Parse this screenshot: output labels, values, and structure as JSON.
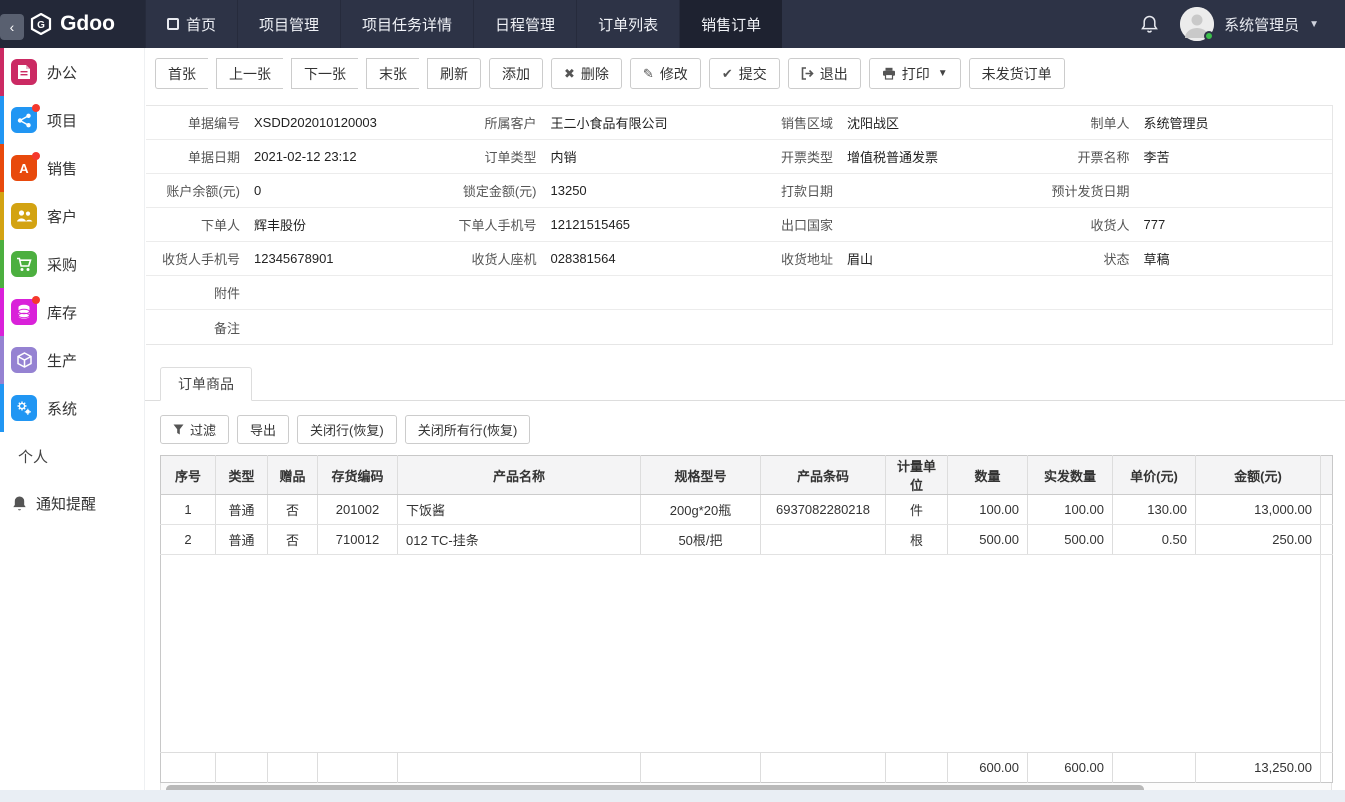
{
  "theme": {
    "navbar_bg": "#2d3346",
    "brand_bg": "#232838",
    "active_nav_bg": "#1e2230",
    "badge_red": "#f5382c",
    "online_green": "#3bbf4a",
    "sidebar_colors": {
      "office": "#cb2a63",
      "project": "#2196f3",
      "sales": "#e8490c",
      "customer": "#d3a312",
      "purchase": "#4caf3f",
      "stock": "#d921d9",
      "produce": "#9582d2",
      "system": "#2196f3"
    }
  },
  "navbar": {
    "brand": "Gdoo",
    "items": [
      {
        "label": "首页",
        "active": false
      },
      {
        "label": "项目管理",
        "active": false
      },
      {
        "label": "项目任务详情",
        "active": false
      },
      {
        "label": "日程管理",
        "active": false
      },
      {
        "label": "订单列表",
        "active": false
      },
      {
        "label": "销售订单",
        "active": true
      }
    ],
    "user": "系统管理员"
  },
  "sidebar": {
    "items": [
      {
        "label": "办公",
        "badge": false
      },
      {
        "label": "项目",
        "badge": true
      },
      {
        "label": "销售",
        "badge": true
      },
      {
        "label": "客户",
        "badge": false
      },
      {
        "label": "采购",
        "badge": false
      },
      {
        "label": "库存",
        "badge": true
      },
      {
        "label": "生产",
        "badge": false
      },
      {
        "label": "系统",
        "badge": false
      }
    ],
    "section_label": "个人",
    "notification_label": "通知提醒"
  },
  "toolbar": {
    "nav_group": [
      "首张",
      "上一张",
      "下一张",
      "末张",
      "刷新"
    ],
    "add": "添加",
    "delete": "删除",
    "edit": "修改",
    "submit": "提交",
    "exit": "退出",
    "print": "打印",
    "unshipped": "未发货订单"
  },
  "form": {
    "rows": [
      [
        {
          "label": "单据编号",
          "value": "XSDD202010120003"
        },
        {
          "label": "所属客户",
          "value": "王二小食品有限公司"
        },
        {
          "label": "销售区域",
          "value": "沈阳战区"
        },
        {
          "label": "制单人",
          "value": "系统管理员"
        }
      ],
      [
        {
          "label": "单据日期",
          "value": "2021-02-12 23:12"
        },
        {
          "label": "订单类型",
          "value": "内销"
        },
        {
          "label": "开票类型",
          "value": "增值税普通发票"
        },
        {
          "label": "开票名称",
          "value": "李苦"
        }
      ],
      [
        {
          "label": "账户余额(元)",
          "value": "0"
        },
        {
          "label": "锁定金额(元)",
          "value": "13250"
        },
        {
          "label": "打款日期",
          "value": ""
        },
        {
          "label": "预计发货日期",
          "value": ""
        }
      ],
      [
        {
          "label": "下单人",
          "value": "辉丰股份"
        },
        {
          "label": "下单人手机号",
          "value": "12121515465"
        },
        {
          "label": "出口国家",
          "value": ""
        },
        {
          "label": "收货人",
          "value": "777"
        }
      ],
      [
        {
          "label": "收货人手机号",
          "value": "12345678901"
        },
        {
          "label": "收货人座机",
          "value": "028381564"
        },
        {
          "label": "收货地址",
          "value": "眉山"
        },
        {
          "label": "状态",
          "value": "草稿"
        }
      ],
      [
        {
          "label": "附件",
          "value": ""
        }
      ],
      [
        {
          "label": "备注",
          "value": ""
        }
      ]
    ]
  },
  "tab": {
    "label": "订单商品"
  },
  "grid_toolbar": {
    "filter": "过滤",
    "export": "导出",
    "close_row": "关闭行(恢复)",
    "close_all": "关闭所有行(恢复)"
  },
  "grid": {
    "headers": [
      "序号",
      "类型",
      "赠品",
      "存货编码",
      "产品名称",
      "规格型号",
      "产品条码",
      "计量单位",
      "数量",
      "实发数量",
      "单价(元)",
      "金额(元)"
    ],
    "rows": [
      [
        "1",
        "普通",
        "否",
        "201002",
        "下饭酱",
        "200g*20瓶",
        "6937082280218",
        "件",
        "100.00",
        "100.00",
        "130.00",
        "13,000.00"
      ],
      [
        "2",
        "普通",
        "否",
        "710012",
        "012 TC-挂条",
        "50根/把",
        "",
        "根",
        "500.00",
        "500.00",
        "0.50",
        "250.00"
      ]
    ],
    "footer": {
      "qty": "600.00",
      "shipped_qty": "600.00",
      "amount": "13,250.00"
    }
  }
}
